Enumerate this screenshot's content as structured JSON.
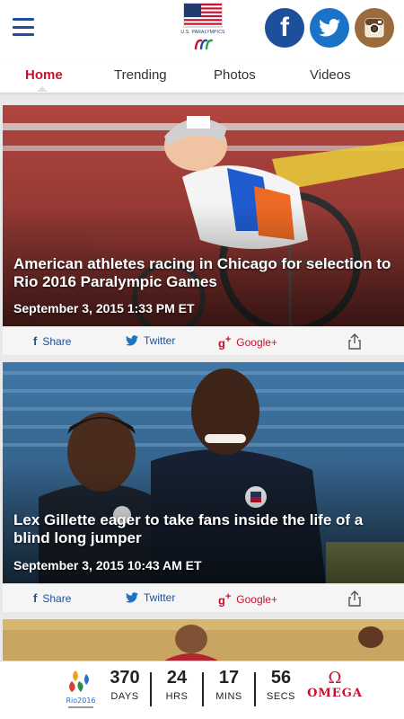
{
  "header": {
    "logo_text": "U.S. PARALYMPICS",
    "facebook": "f"
  },
  "tabs": [
    {
      "label": "Home",
      "active": true
    },
    {
      "label": "Trending",
      "active": false
    },
    {
      "label": "Photos",
      "active": false
    },
    {
      "label": "Videos",
      "active": false
    }
  ],
  "articles": [
    {
      "title": "American athletes racing in Chicago for selection to Rio 2016 Paralympic Games",
      "date": "September 3, 2015 1:33 PM ET",
      "share": {
        "facebook": "Share",
        "twitter": "Twitter",
        "google": "Google+"
      }
    },
    {
      "title": "Lex Gillette eager to take fans inside the life of a blind long jumper",
      "date": "September 3, 2015 10:43 AM ET",
      "share": {
        "facebook": "Share",
        "twitter": "Twitter",
        "google": "Google+"
      }
    }
  ],
  "countdown": {
    "days": {
      "value": "370",
      "label": "DAYS"
    },
    "hrs": {
      "value": "24",
      "label": "HRS"
    },
    "mins": {
      "value": "17",
      "label": "MINS"
    },
    "secs": {
      "value": "56",
      "label": "SECS"
    },
    "sponsor": "OMEGA",
    "rio_text": "Rio2016"
  },
  "colors": {
    "accent_red": "#c8102e",
    "brand_blue": "#1d4f9b",
    "twitter_blue": "#1a73c7",
    "instagram_brown": "#9b6a3d"
  }
}
